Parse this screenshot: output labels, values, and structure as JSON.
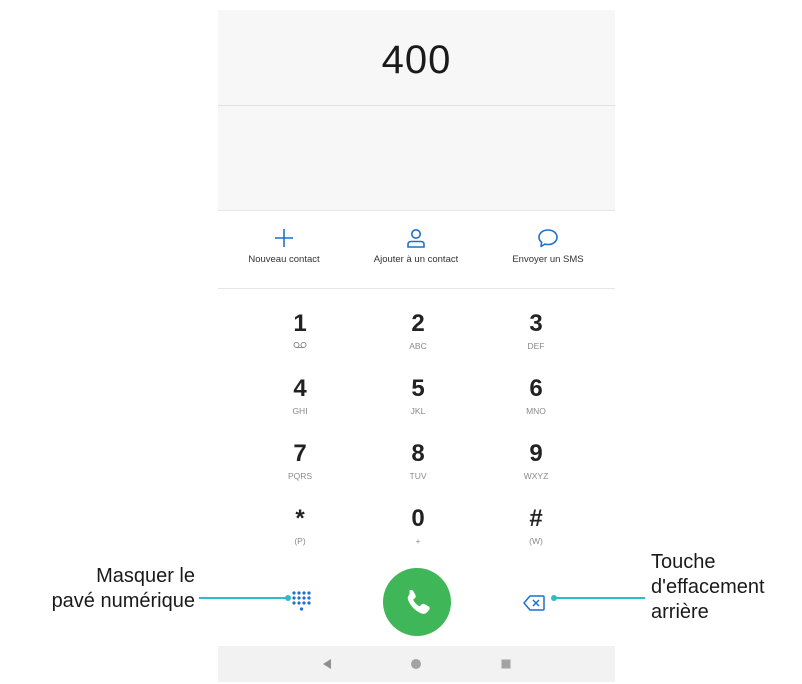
{
  "display": {
    "number": "400"
  },
  "actions": [
    {
      "label": "Nouveau contact",
      "icon": "plus-icon"
    },
    {
      "label": "Ajouter à un contact",
      "icon": "person-icon"
    },
    {
      "label": "Envoyer un SMS",
      "icon": "message-bubble-icon"
    }
  ],
  "keypad": [
    {
      "digit": "1",
      "letters": "ꝏ",
      "icon": "voicemail-icon"
    },
    {
      "digit": "2",
      "letters": "ABC"
    },
    {
      "digit": "3",
      "letters": "DEF"
    },
    {
      "digit": "4",
      "letters": "GHI"
    },
    {
      "digit": "5",
      "letters": "JKL"
    },
    {
      "digit": "6",
      "letters": "MNO"
    },
    {
      "digit": "7",
      "letters": "PQRS"
    },
    {
      "digit": "8",
      "letters": "TUV"
    },
    {
      "digit": "9",
      "letters": "WXYZ"
    },
    {
      "digit": "*",
      "letters": "(P)"
    },
    {
      "digit": "0",
      "letters": "+"
    },
    {
      "digit": "#",
      "letters": "(W)"
    }
  ],
  "bottom": {
    "hide_keypad_icon": "dialpad-grid-icon",
    "call_icon": "phone-icon",
    "backspace_icon": "backspace-icon"
  },
  "navbar": {
    "back_icon": "back-triangle-icon",
    "home_icon": "home-circle-icon",
    "recents_icon": "recents-square-icon"
  },
  "callouts": {
    "hide_keypad": [
      "Masquer le",
      "pavé numérique"
    ],
    "backspace": [
      "Touche",
      "d'effacement",
      "arrière"
    ]
  },
  "colors": {
    "accent_blue": "#1f6fd1",
    "call_green": "#3fb657",
    "leader_cyan": "#2bbcc9"
  }
}
